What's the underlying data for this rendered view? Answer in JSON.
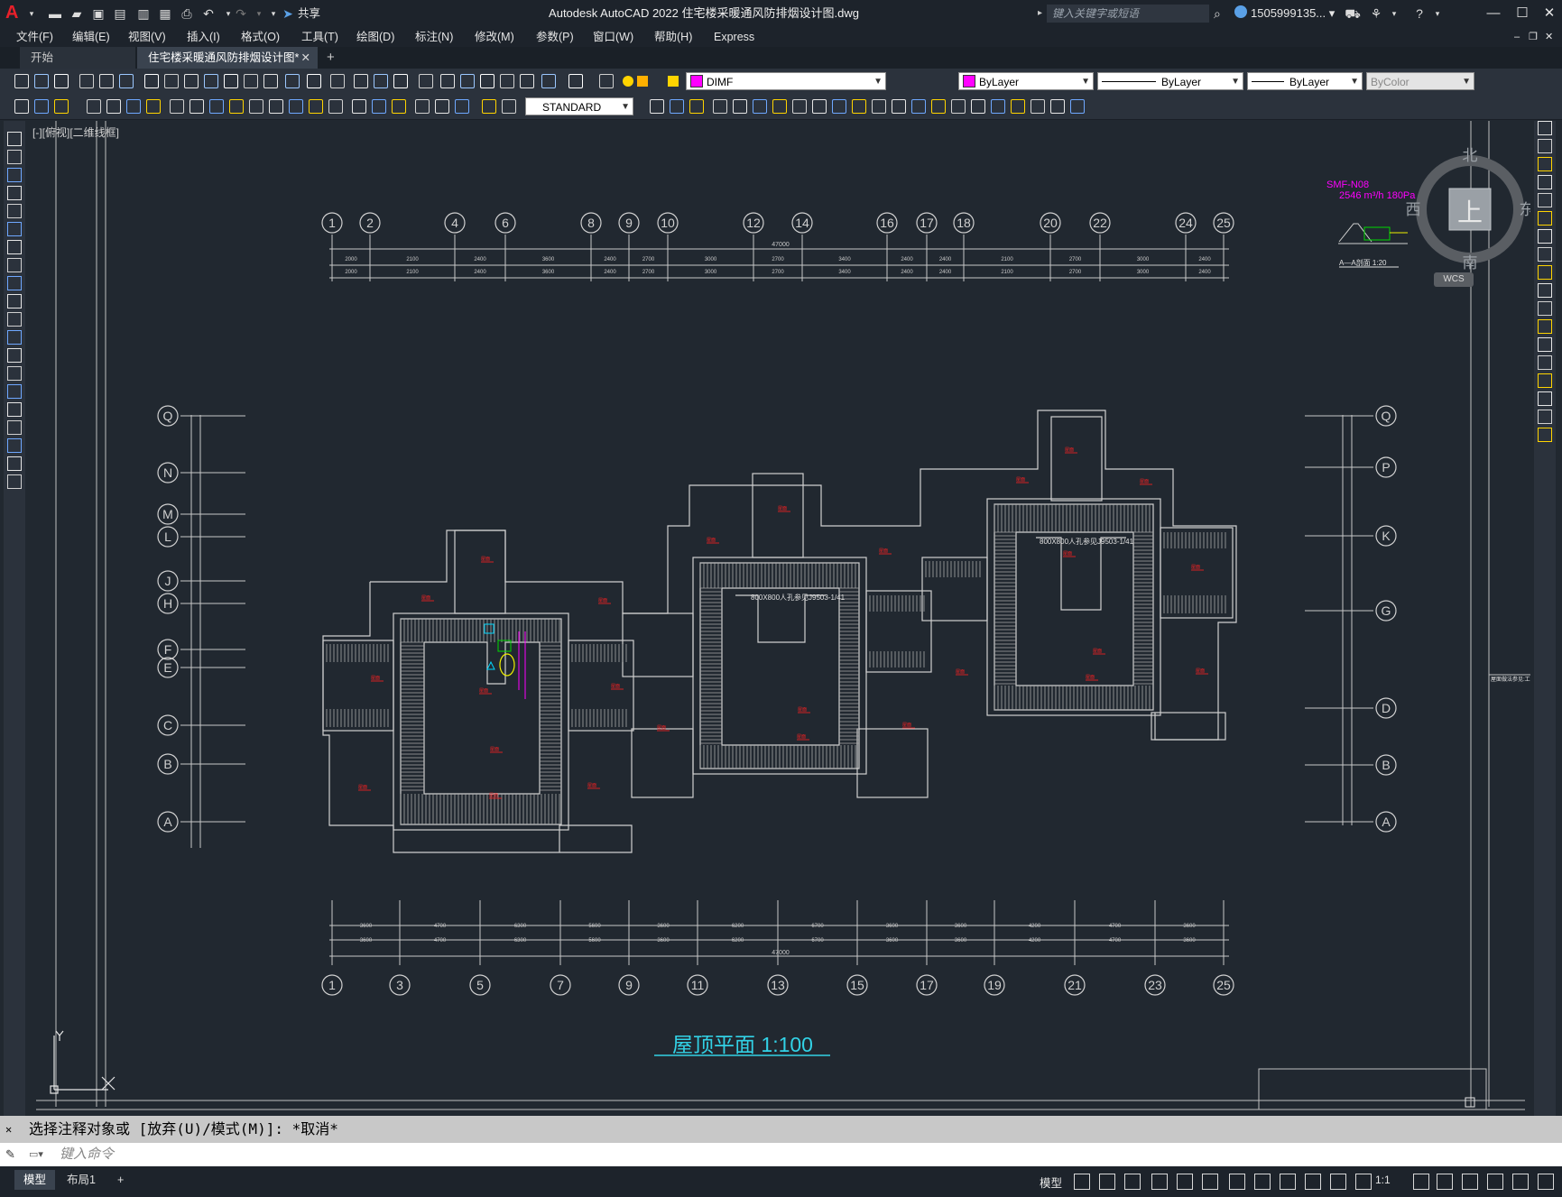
{
  "app": {
    "logo_letter": "A",
    "title": "Autodesk AutoCAD 2022    住宅楼采暖通风防排烟设计图.dwg",
    "search_placeholder": "键入关键字或短语",
    "user": "1505999135... ▾",
    "share_label": "共享"
  },
  "menu": [
    "文件(F)",
    "编辑(E)",
    "视图(V)",
    "插入(I)",
    "格式(O)",
    "工具(T)",
    "绘图(D)",
    "标注(N)",
    "修改(M)",
    "参数(P)",
    "窗口(W)",
    "帮助(H)",
    "Express"
  ],
  "tabs": [
    {
      "label": "开始"
    },
    {
      "label": "住宅楼采暖通风防排烟设计图*"
    }
  ],
  "properties": {
    "layer": "DIMF",
    "color": "ByLayer",
    "linetype": "ByLayer",
    "lineweight": "ByLayer",
    "plotstyle": "ByColor",
    "textstyle": "STANDARD",
    "layer_color_hex": "#ff00ff"
  },
  "viewport": {
    "label": "[-][俯视][二维线框]"
  },
  "viewcube": {
    "north": "北",
    "south": "南",
    "east": "东",
    "west": "西",
    "face": "上",
    "wcs": "WCS"
  },
  "drawing": {
    "title": "屋顶平面 1:100",
    "section_label": "A—A剖面 1:20",
    "section_note_1": "SMF-N08",
    "section_note_2": "2546 m³/h 180Pa",
    "top_axes": [
      "1",
      "2",
      "4",
      "6",
      "8",
      "9",
      "10",
      "12",
      "14",
      "16",
      "17",
      "18",
      "20",
      "22",
      "24",
      "25"
    ],
    "bottom_axes": [
      "1",
      "3",
      "5",
      "7",
      "9",
      "11",
      "13",
      "15",
      "17",
      "19",
      "21",
      "23",
      "25"
    ],
    "left_axes": [
      "Q",
      "N",
      "M",
      "L",
      "J",
      "H",
      "F",
      "E",
      "C",
      "B",
      "A"
    ],
    "right_axes": [
      "Q",
      "P",
      "K",
      "G",
      "D",
      "B",
      "A"
    ],
    "total_dim": "47000",
    "top_dims": [
      "2000",
      "2100",
      "2400",
      "3600",
      "2400",
      "2700",
      "3000",
      "2700",
      "3400",
      "2400",
      "2400",
      "2100",
      "2700",
      "3000",
      "2400",
      "2100"
    ],
    "bottom_dims": [
      "3600",
      "4700",
      "6300",
      "5600",
      "3600",
      "6200",
      "6700",
      "3600",
      "3600",
      "4200",
      "4700",
      "3600"
    ],
    "room_tag": "屋面",
    "fan_tag_left": "800X800人孔参见J9503-1/41",
    "fan_tag_right": "800X800人孔参见J9503-1/41",
    "side_note": "屋面做法参见:工..."
  },
  "command": {
    "history": "选择注释对象或 [放弃(U)/模式(M)]: *取消*",
    "input_placeholder": "键入命令"
  },
  "status": {
    "model_tab": "模型",
    "layout_tab": "布局1",
    "add_tab": "+",
    "model_label": "模型",
    "scale": "1:1"
  },
  "colors": {
    "canvas": "#212830",
    "lines": "#c8c8c8",
    "accent_red": "#ff2020",
    "magenta": "#ff00ff",
    "cyan": "#00d8ff",
    "yellow": "#f0f000",
    "title_cyan": "#32d2e6"
  }
}
